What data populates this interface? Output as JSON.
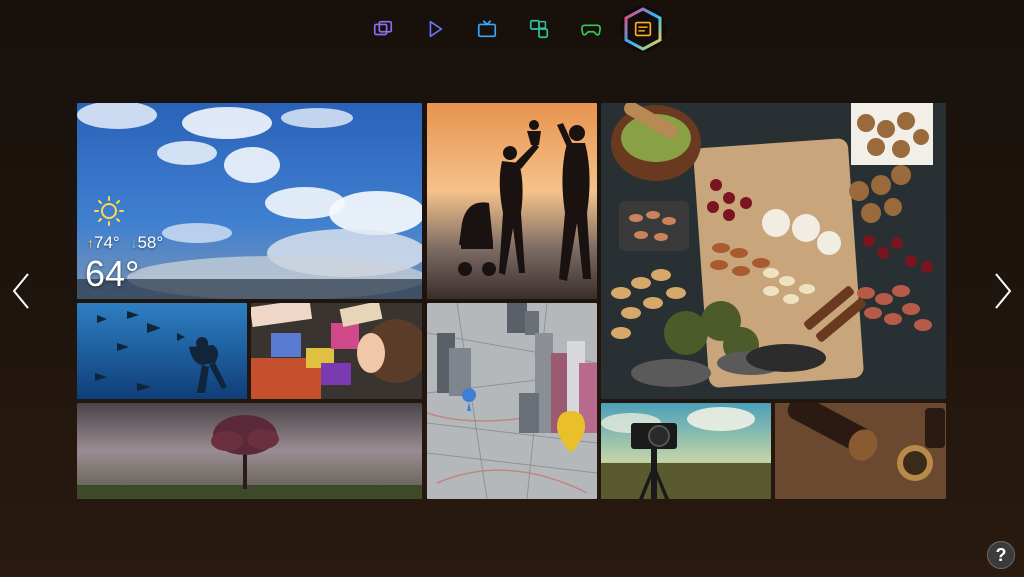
{
  "nav": {
    "items": [
      {
        "id": "multi-screen",
        "icon": "multiscreen-icon",
        "color": "#8f6cf0"
      },
      {
        "id": "play",
        "icon": "play-icon",
        "color": "#6b74ff"
      },
      {
        "id": "tv",
        "icon": "tv-icon",
        "color": "#3aa7ff"
      },
      {
        "id": "apps",
        "icon": "apps-icon",
        "color": "#2fc4a0"
      },
      {
        "id": "games",
        "icon": "gamepad-icon",
        "color": "#36c75a"
      },
      {
        "id": "panel",
        "icon": "panel-icon",
        "color": "#ffb020",
        "active": true
      }
    ]
  },
  "weather": {
    "high": "74°",
    "low": "58°",
    "current": "64°",
    "condition_icon": "sun-icon"
  },
  "help": {
    "label": "?"
  },
  "colors": {
    "active_ring_a": "#ff3b6b",
    "active_ring_b": "#2db6ff",
    "active_ring_c": "#ffd33b"
  }
}
